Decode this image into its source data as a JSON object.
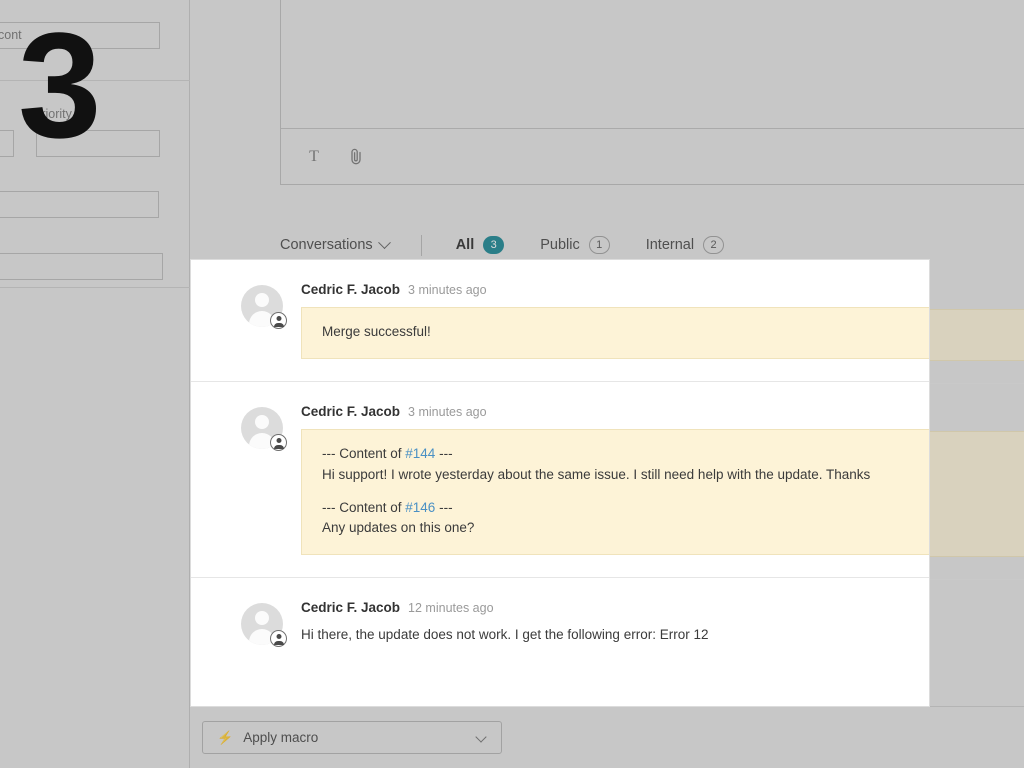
{
  "step_number": "3",
  "sidebar": {
    "truncated_label": "cont",
    "priority_label": "Priority",
    "fields": [
      {
        "name": "contact-field",
        "value": ""
      },
      {
        "name": "priority-small-field",
        "value": ""
      },
      {
        "name": "priority-field",
        "value": ""
      },
      {
        "name": "owner-field",
        "value": ""
      },
      {
        "name": "type-field",
        "value": ""
      }
    ]
  },
  "composer": {
    "value": "",
    "placeholder": "",
    "toolbar": {
      "format_text_label": "T",
      "attachment_icon": "paperclip-icon"
    }
  },
  "tabs": {
    "conversations_label": "Conversations",
    "items": [
      {
        "label": "All",
        "count": "3",
        "active": true,
        "style": "solid"
      },
      {
        "label": "Public",
        "count": "1",
        "active": false,
        "style": "hollow"
      },
      {
        "label": "Internal",
        "count": "2",
        "active": false,
        "style": "hollow"
      }
    ]
  },
  "conversation": {
    "messages": [
      {
        "author": "Cedric F. Jacob",
        "time": "3 minutes ago",
        "bubble": true,
        "lines": [
          {
            "type": "text",
            "text": "Merge successful!"
          }
        ]
      },
      {
        "author": "Cedric F. Jacob",
        "time": "3 minutes ago",
        "bubble": true,
        "lines": [
          {
            "type": "ref",
            "pre": "--- Content of ",
            "link": "#144",
            "post": " ---"
          },
          {
            "type": "text",
            "text": "Hi support! I wrote yesterday about the same issue. I still need help with the update. Thanks"
          },
          {
            "type": "spacer"
          },
          {
            "type": "ref",
            "pre": "--- Content of ",
            "link": "#146",
            "post": " ---"
          },
          {
            "type": "text",
            "text": "Any updates on this one?"
          }
        ]
      },
      {
        "author": "Cedric F. Jacob",
        "time": "12 minutes ago",
        "bubble": false,
        "lines": [
          {
            "type": "text",
            "text": "Hi there, the update does not work. I get the following error: Error 12"
          }
        ]
      }
    ]
  },
  "footer": {
    "macro_label": "Apply macro",
    "macro_icon": "lightning-bolt-icon"
  },
  "colors": {
    "accent_teal": "#0b7f8c",
    "active_underline": "#009aa6",
    "bubble_bg": "#fdf3d7",
    "link_blue": "#4a90c4",
    "app_bg": "#e4e4e4"
  }
}
